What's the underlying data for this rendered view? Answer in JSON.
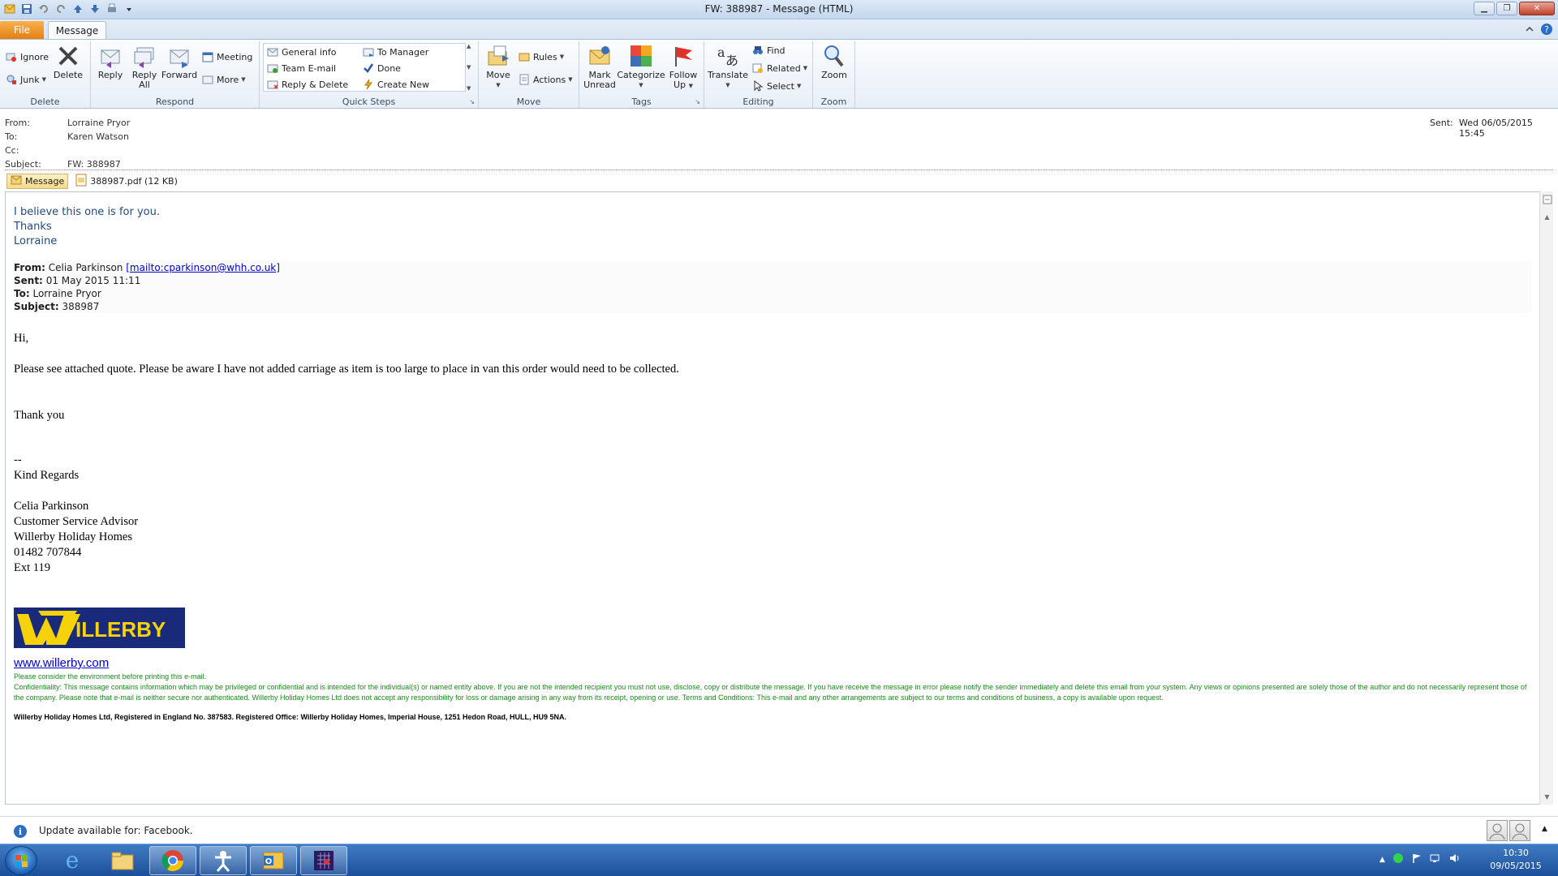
{
  "window": {
    "title": "FW: 388987  -  Message (HTML)",
    "controls": [
      "minimize",
      "maximize",
      "close"
    ]
  },
  "tabs": {
    "file": "File",
    "message": "Message"
  },
  "ribbon": {
    "delete_group": {
      "label": "Delete",
      "ignore": "Ignore",
      "junk": "Junk",
      "delete": "Delete"
    },
    "respond_group": {
      "label": "Respond",
      "reply": "Reply",
      "reply_all_1": "Reply",
      "reply_all_2": "All",
      "forward": "Forward",
      "meeting": "Meeting",
      "more": "More"
    },
    "quicksteps_group": {
      "label": "Quick Steps",
      "items": [
        "General info",
        "To Manager",
        "Team E-mail",
        "Done",
        "Reply & Delete",
        "Create New"
      ]
    },
    "move_group": {
      "label": "Move",
      "move": "Move",
      "rules": "Rules",
      "actions": "Actions"
    },
    "tags_group": {
      "label": "Tags",
      "mark_unread_1": "Mark",
      "mark_unread_2": "Unread",
      "categorize": "Categorize",
      "follow_up_1": "Follow",
      "follow_up_2": "Up"
    },
    "editing_group": {
      "label": "Editing",
      "translate": "Translate",
      "find": "Find",
      "related": "Related",
      "select": "Select"
    },
    "zoom_group": {
      "label": "Zoom",
      "zoom": "Zoom"
    }
  },
  "header": {
    "from_label": "From:",
    "from": "Lorraine Pryor",
    "to_label": "To:",
    "to": "Karen Watson",
    "cc_label": "Cc:",
    "cc": "",
    "subject_label": "Subject:",
    "subject": "FW: 388987",
    "sent_label": "Sent:",
    "sent": "Wed 06/05/2015 15:45"
  },
  "attachments": {
    "message_tab": "Message",
    "file": "388987.pdf (12 KB)"
  },
  "body": {
    "intro": [
      "I believe this one is for you.",
      "Thanks",
      "Lorraine"
    ],
    "fwd_from_label": "From:",
    "fwd_from": "Celia Parkinson",
    "fwd_from_link": "[mailto:cparkinson@whh.co.uk]",
    "fwd_sent_label": "Sent:",
    "fwd_sent": "01 May 2015 11:11",
    "fwd_to_label": "To:",
    "fwd_to": "Lorraine Pryor",
    "fwd_subject_label": "Subject:",
    "fwd_subject": "388987",
    "greeting": "Hi,",
    "paragraph": "Please see attached quote. Please be aware I have not added carriage as item is too large to place in van this order would need to be collected.",
    "thanks": "Thank you",
    "sig_dash": "--",
    "kind_regards": "Kind Regards",
    "sig_name": "Celia Parkinson",
    "sig_title": "Customer Service Advisor",
    "sig_company": "Willerby Holiday Homes",
    "sig_phone": "01482 707844",
    "sig_ext": "Ext 119",
    "logo_text": "WILLERBY",
    "website": "www.willerby.com",
    "env_note": "Please consider the environment before printing this e-mail.",
    "confidentiality": "Confidentiality: This message contains information which may be privileged or confidential and is intended for the individual(s) or named entity above. If you are not the intended recipient you must not use, disclose, copy or distribute the message. If you have receive the message in error please notify the sender immediately and delete this email from your system. Any views or opinions presented are solely those of the author and do not necessarily represent those of the company. Please note that e-mail is neither secure nor authenticated. Willerby Holiday Homes Ltd does not accept any responsibility for loss or damage arising in any way from its receipt, opening or use. Terms and Conditions: This e-mail and any other arrangements are subject to our terms and conditions of business, a copy is available upon request.",
    "registration": "Willerby Holiday Homes Ltd, Registered in England No. 387583. Registered Office: Willerby Holiday Homes, Imperial House, 1251 Hedon Road, HULL, HU9 5NA."
  },
  "infobar": {
    "text": "Update available for: Facebook."
  },
  "taskbar": {
    "apps": [
      "start-button",
      "internet-explorer-icon",
      "file-explorer-icon",
      "chrome-icon",
      "app-icon",
      "outlook-icon",
      "calendar-app-icon"
    ],
    "time": "10:30",
    "date": "09/05/2015"
  },
  "colors": {
    "ribbon_file_tab": "#e47f13",
    "body_intro_text": "#1f497d",
    "disclaimer_green": "#1a8a1a",
    "logo_navy": "#1a2a7a",
    "logo_yellow": "#f5d20a",
    "taskbar": "#1c4f99"
  }
}
